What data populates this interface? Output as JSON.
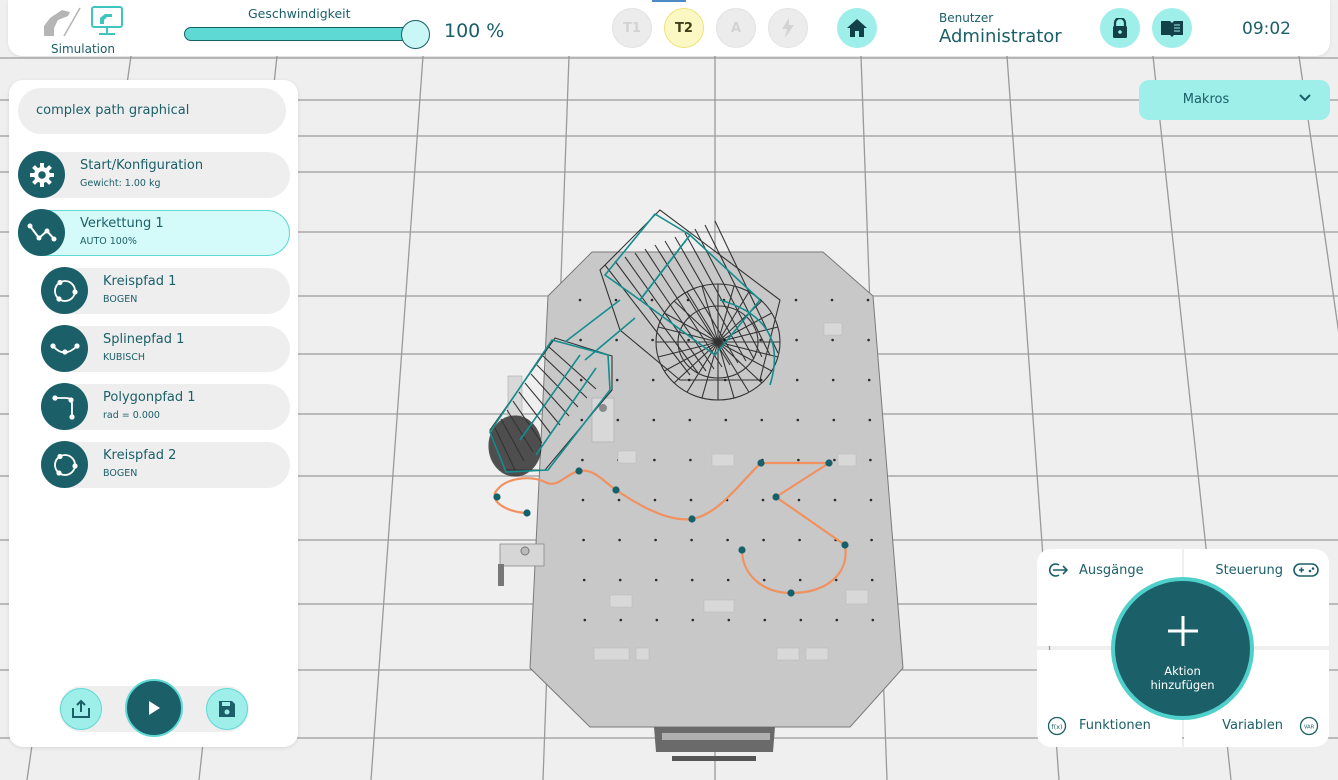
{
  "colors": {
    "accent_dark": "#1b5f68",
    "accent_light": "#9eeeea",
    "accent_mid": "#5ed9d4",
    "active_item_bg": "#d4fbf9",
    "path_color": "#f0915f",
    "waypoint_color": "#15616b",
    "robot_wire_teal": "#138e8e"
  },
  "header": {
    "mode_icons": [
      "robot-arm-icon",
      "monitor-robot-icon"
    ],
    "mode_label": "Simulation",
    "speed_label": "Geschwindigkeit",
    "speed_percent": 100,
    "speed_value": "100 %",
    "operating_modes": [
      {
        "label": "T1",
        "active": false
      },
      {
        "label": "T2",
        "active": true
      },
      {
        "label": "A",
        "active": false
      },
      {
        "label": "",
        "icon": "lightning-icon",
        "active": false
      }
    ],
    "home_icon": "home-icon",
    "user_label": "Benutzer",
    "user_name": "Administrator",
    "lock_icon": "lock-icon",
    "manual_icon": "book-icon",
    "time": "09:02"
  },
  "program": {
    "name": "complex path graphical",
    "items": [
      {
        "title": "Start/Konfiguration",
        "subtitle": "Gewicht: 1.00 kg",
        "icon": "gear-icon",
        "level": 0,
        "active": false
      },
      {
        "title": "Verkettung 1",
        "subtitle": "AUTO  100%",
        "icon": "chain-path-icon",
        "level": 0,
        "active": true
      },
      {
        "title": "Kreispfad 1",
        "subtitle": "BOGEN",
        "icon": "circle-path-icon",
        "level": 1,
        "active": false
      },
      {
        "title": "Splinepfad 1",
        "subtitle": "KUBISCH",
        "icon": "spline-path-icon",
        "level": 1,
        "active": false
      },
      {
        "title": "Polygonpfad 1",
        "subtitle": "rad = 0.000",
        "icon": "polygon-path-icon",
        "level": 1,
        "active": false
      },
      {
        "title": "Kreispfad 2",
        "subtitle": "BOGEN",
        "icon": "circle-path-icon",
        "level": 1,
        "active": false
      }
    ],
    "controls": [
      "export-icon",
      "play-icon",
      "save-icon"
    ]
  },
  "macros": {
    "label": "Makros"
  },
  "actions": {
    "outputs_label": "Ausgänge",
    "control_label": "Steuerung",
    "functions_label": "Funktionen",
    "variables_label": "Variablen",
    "add_label_line1": "Aktion",
    "add_label_line2": "hinzufügen"
  }
}
